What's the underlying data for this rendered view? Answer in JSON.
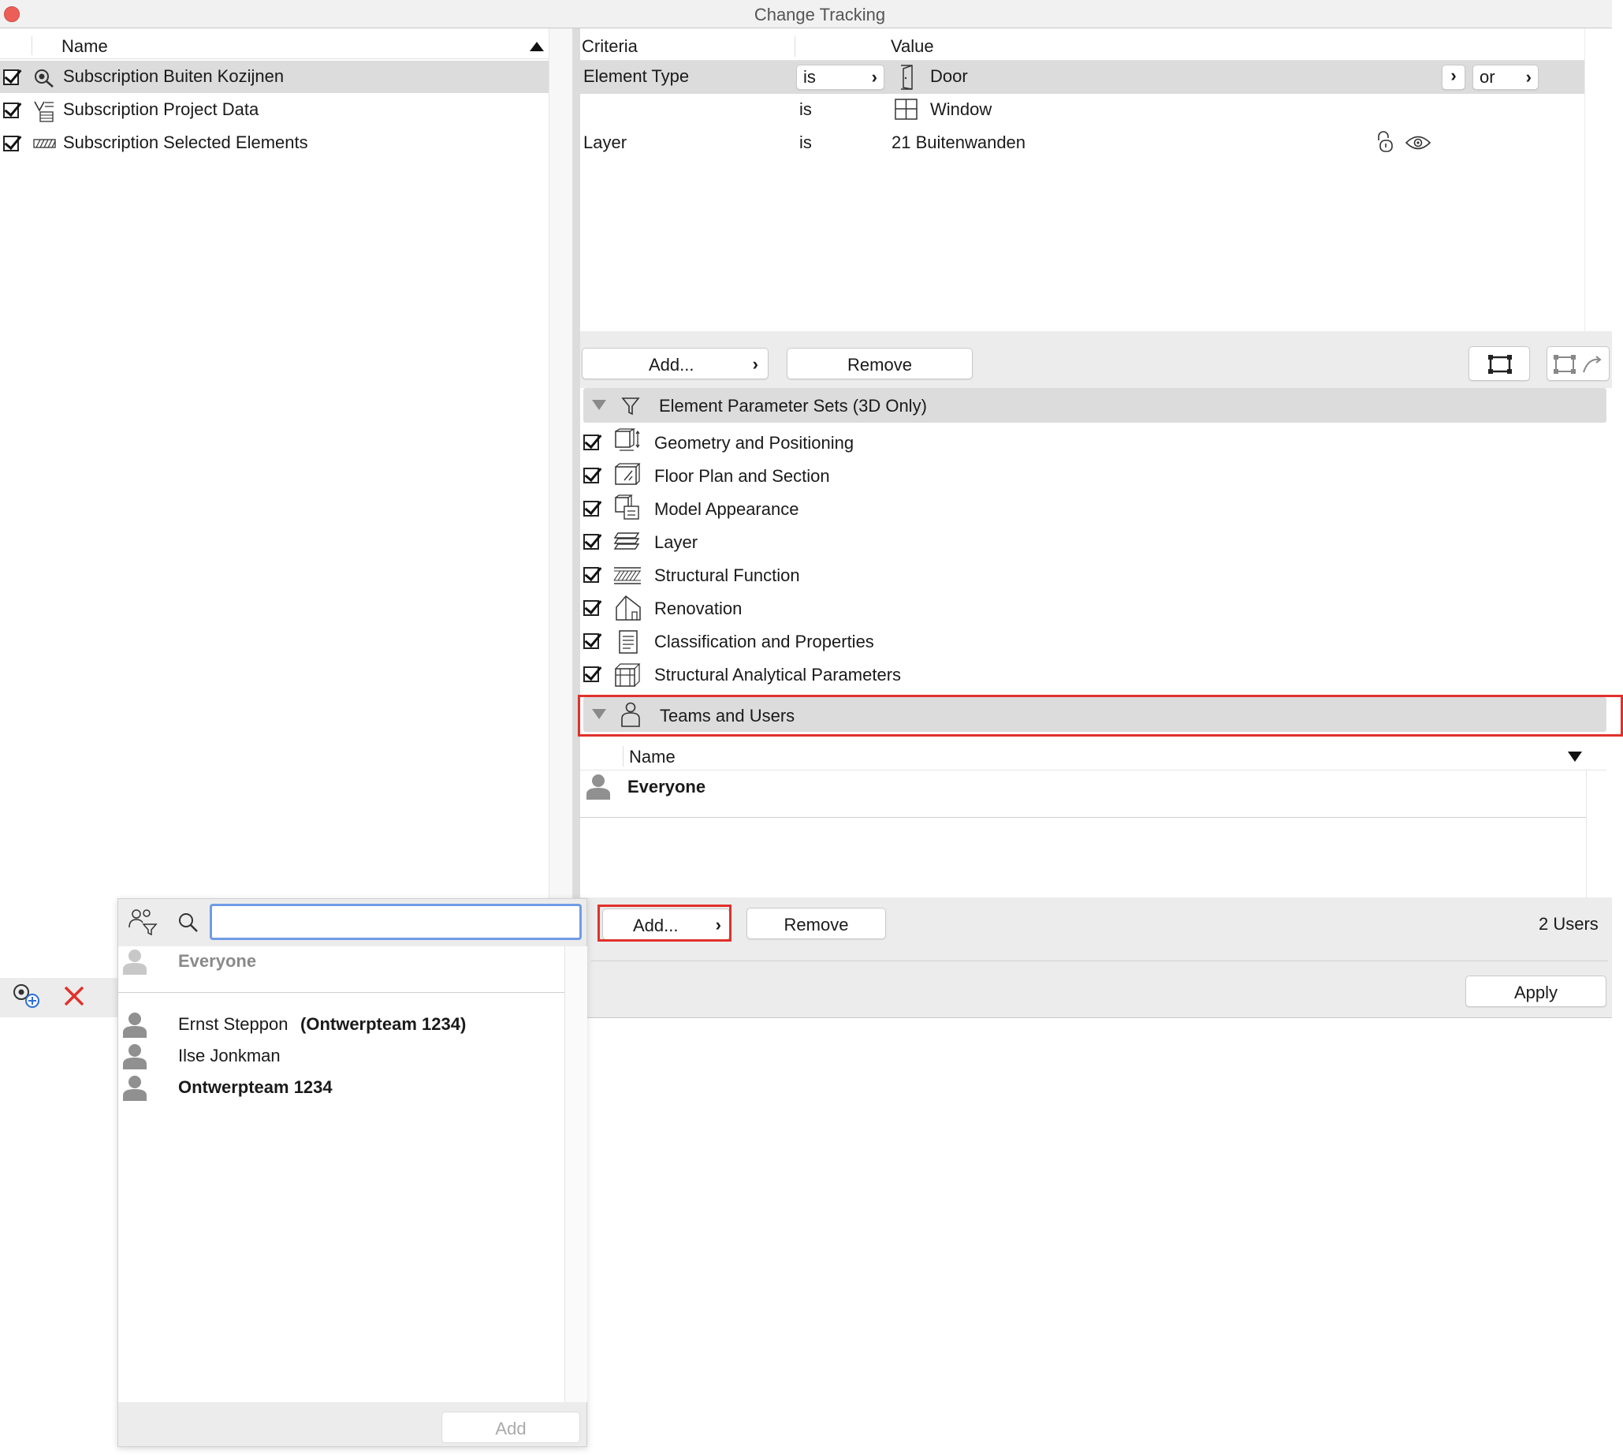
{
  "window": {
    "title": "Change Tracking"
  },
  "subscriptions": {
    "column_header": "Name",
    "items": [
      {
        "label": "Subscription Buiten Kozijnen"
      },
      {
        "label": "Subscription Project Data"
      },
      {
        "label": "Subscription Selected Elements"
      }
    ]
  },
  "criteria": {
    "header_criteria": "Criteria",
    "header_value": "Value",
    "rows": [
      {
        "criteria": "Element Type",
        "operator": "is",
        "value": "Door",
        "logic": "or"
      },
      {
        "criteria": "",
        "operator": "is",
        "value": "Window"
      },
      {
        "criteria": "Layer",
        "operator": "is",
        "value": "21 Buitenwanden"
      }
    ],
    "add_label": "Add...",
    "remove_label": "Remove"
  },
  "parameter_sets": {
    "title": "Element Parameter Sets (3D Only)",
    "items": [
      {
        "label": "Geometry and Positioning",
        "icon": "geometry-icon"
      },
      {
        "label": "Floor Plan and Section",
        "icon": "floor-plan-icon"
      },
      {
        "label": "Model Appearance",
        "icon": "model-appearance-icon"
      },
      {
        "label": "Layer",
        "icon": "layer-icon"
      },
      {
        "label": "Structural Function",
        "icon": "structural-function-icon"
      },
      {
        "label": "Renovation",
        "icon": "renovation-icon"
      },
      {
        "label": "Classification and Properties",
        "icon": "classification-icon"
      },
      {
        "label": "Structural Analytical Parameters",
        "icon": "structural-analytical-icon"
      }
    ]
  },
  "teams": {
    "title": "Teams and Users",
    "column_header": "Name",
    "rows": [
      {
        "label": "Everyone"
      }
    ],
    "add_label": "Add...",
    "remove_label": "Remove",
    "count_label": "2 Users"
  },
  "apply_label": "Apply",
  "popup": {
    "search_value": "",
    "top_item": "Everyone",
    "users": [
      {
        "name": "Ernst Steppon",
        "team": "(Ontwerpteam 1234)"
      },
      {
        "name": "Ilse Jonkman",
        "team": ""
      },
      {
        "name": "Ontwerpteam 1234",
        "team": ""
      }
    ],
    "add_label": "Add"
  },
  "colors": {
    "highlight": "#e0312b",
    "selection": "#dcdcdc",
    "focus": "#6f9be6"
  }
}
